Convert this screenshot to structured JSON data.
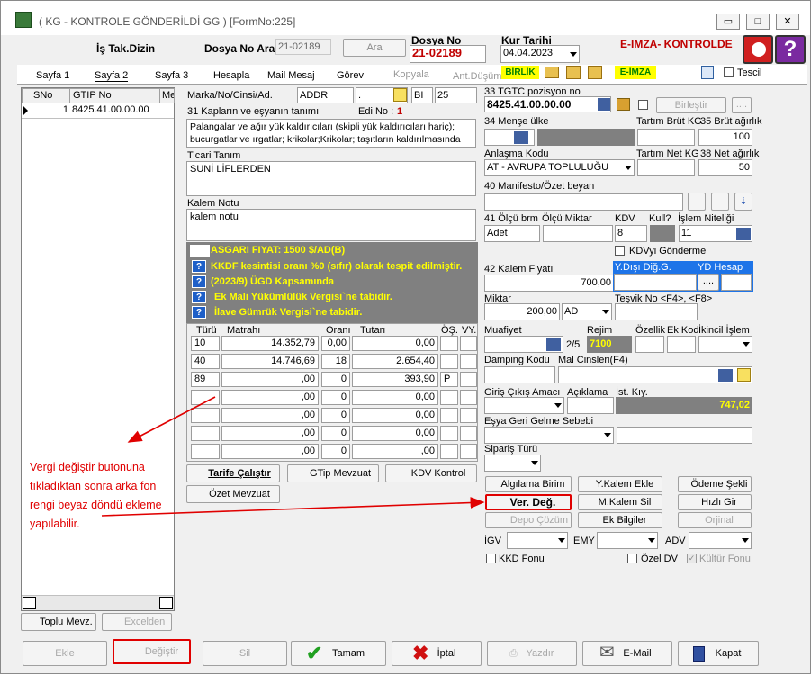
{
  "window": {
    "title": "( KG  - KONTROLE GÖNDERİLDİ GG ) [FormNo:225]"
  },
  "header": {
    "is_takip": "İş Tak.Dizin",
    "dosya_no_ara_label": "Dosya No Ara",
    "dosya_no_ara_value": "21-02189",
    "ara_button": "Ara",
    "dosya_no_label": "Dosya No",
    "dosya_no_value": "21-02189",
    "kur_tarihi_label": "Kur Tarihi",
    "kur_tarihi_value": "04.04.2023",
    "eimza_status": "E-IMZA- KONTROLDE"
  },
  "tabs": [
    "Sayfa 1",
    "Sayfa 2",
    "Sayfa 3",
    "Hesapla",
    "Mail Mesaj",
    "Görev",
    "Kopyala",
    "Ant.Düşüm"
  ],
  "toolbar": {
    "birlik": "BİRLİK",
    "eimza": "E-İMZA",
    "tescil": "Tescil"
  },
  "grid": {
    "headers": [
      "SNo",
      "GTIP No",
      "Me"
    ],
    "rows": [
      {
        "sno": "1",
        "gtip": "8425.41.00.00.00"
      }
    ]
  },
  "left_bottom": {
    "toplu": "Toplu Mevz.",
    "excelden": "Excelden"
  },
  "marka": {
    "label": "Marka/No/Cinsi/Ad.",
    "value": "ADDR",
    "dot": ".",
    "bi": "BI",
    "bi_num": "25"
  },
  "kap": {
    "label": "31 Kapların ve eşyanın tanımı",
    "edi_label": "Edi No :",
    "edi_value": "1",
    "text": "Palangalar ve ağır yük kaldırıcıları (skipli yük kaldırıcıları hariç); bucurgatlar ve ırgatlar; krikolar;Krikolar; taşıtların kaldırılmasında"
  },
  "ticari": {
    "label": "Ticari Tanım",
    "value": "SUNİ LİFLERDEN"
  },
  "kalem_notu": {
    "label": "Kalem Notu",
    "value": "kalem notu"
  },
  "warnings": [
    "ASGARI FIYAT: 1500 $/AD(B)",
    "KKDF kesintisi oranı %0 (sıfır) olarak tespit edilmiştir.",
    "(2023/9) ÜGD Kapsamında",
    "Ek Mali Yükümlülük Vergisi`ne tabidir.",
    "İlave Gümrük Vergisi`ne tabidir."
  ],
  "vergi": {
    "headers": [
      "Türü",
      "Matrahı",
      "Oranı",
      "Tutarı",
      "ÖŞ.",
      "VY."
    ],
    "rows": [
      [
        "10",
        "14.352,79",
        "0,00",
        "0,00",
        "",
        ""
      ],
      [
        "40",
        "14.746,69",
        "18",
        "2.654,40",
        "",
        ""
      ],
      [
        "89",
        ",00",
        "0",
        "393,90",
        "P",
        ""
      ],
      [
        "",
        ",00",
        "0",
        "0,00",
        "",
        ""
      ],
      [
        "",
        ",00",
        "0",
        "0,00",
        "",
        ""
      ],
      [
        "",
        ",00",
        "0",
        "0,00",
        "",
        ""
      ],
      [
        "",
        ",00",
        "0",
        ",00",
        "",
        ""
      ]
    ]
  },
  "mid_buttons": {
    "tarife": "Tarife Çalıştır",
    "gtip": "GTip Mevzuat",
    "kdv": "KDV Kontrol",
    "ozet": "Özet Mevzuat"
  },
  "right": {
    "tgtc_label": "33 TGTC pozisyon no",
    "tgtc_value": "8425.41.00.00.00",
    "birlestir": "Birleştir",
    "mense_label": "34 Menşe ülke",
    "tartim_brut_label": "Tartım Brüt KG",
    "brut_label": "35 Brüt ağırlık",
    "brut_value": "100",
    "anlasma_label": "Anlaşma Kodu",
    "anlasma_value": "AT    - AVRUPA TOPLULUĞU",
    "tartim_net_label": "Tartım Net KG",
    "net_label": "38 Net ağırlık",
    "net_value": "50",
    "manifesto_label": "40 Manifesto/Özet beyan",
    "olcu_label": "41 Ölçü brm",
    "olcu_miktar_label": "Ölçü Miktar",
    "kdv_label": "KDV",
    "kull_label": "Kull?",
    "islem_label": "İşlem Niteliği",
    "olcu_value": "Adet",
    "kdv_value": "8",
    "islem_value": "11",
    "kdv_gonderme": "KDVyi Gönderme",
    "kalem_fiyati_label": "42 Kalem Fiyatı",
    "kalem_fiyati_value": "700,00",
    "ydisi_label": "Y.Dışı Diğ.G.",
    "yd_hesap_label": "YD Hesap",
    "miktar_label": "Miktar",
    "miktar_value": "200,00",
    "miktar_unit": "AD",
    "tesvik_label": "Teşvik No <F4>, <F8>",
    "muafiyet_label": "Muafiyet",
    "muaf_count": "2/5",
    "rejim_label": "Rejim",
    "rejim_value": "7100",
    "ozellik_label": "Özellik",
    "ek_kod_label": "Ek Kod",
    "ikincil_label": "İkincil İşlem",
    "damping_label": "Damping Kodu",
    "mal_cinsleri_label": "Mal Cinsleri(F4)",
    "giris_label": "Giriş Çıkış Amacı",
    "aciklama_label": "Açıklama",
    "ist_kiy_label": "İst. Kıy.",
    "ist_kiy_value": "747,02",
    "esya_label": "Eşya Geri Gelme Sebebi",
    "siparis_label": "Sipariş Türü"
  },
  "action_buttons": {
    "algilama": "Algılama Birim",
    "y_kalem": "Y.Kalem Ekle",
    "odeme": "Ödeme Şekli",
    "ver_deg": "Ver. Değ.",
    "m_kalem": "M.Kalem Sil",
    "hizli": "Hızlı Gir",
    "depo": "Depo Çözüm",
    "ek_bilgiler": "Ek Bilgiler",
    "orjinal": "Orjinal"
  },
  "combos": {
    "igv": "İGV",
    "emy": "EMY",
    "adv": "ADV"
  },
  "checks": {
    "kkd": "KKD Fonu",
    "ozel_dv": "Özel DV",
    "kultur": "Kültür Fonu"
  },
  "annotation": {
    "line1": "Vergi değiştir butonuna",
    "line2": "tıkladıktan sonra arka fon",
    "line3": "rengi beyaz döndü ekleme",
    "line4": "yapılabilir.",
    "color": "#e00000"
  },
  "footer": {
    "ekle": "Ekle",
    "degistir": "Değiştir",
    "sil": "Sil",
    "tamam": "Tamam",
    "iptal": "İptal",
    "yazdir": "Yazdır",
    "email": "E-Mail",
    "kapat": "Kapat"
  }
}
